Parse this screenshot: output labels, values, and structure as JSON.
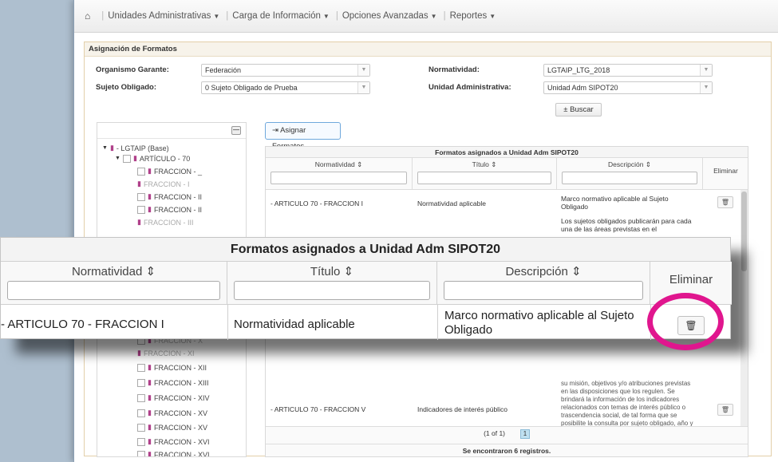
{
  "nav": {
    "items": [
      {
        "label": "Unidades Administrativas"
      },
      {
        "label": "Carga de Información"
      },
      {
        "label": "Opciones Avanzadas"
      },
      {
        "label": "Reportes"
      }
    ]
  },
  "panel": {
    "title": "Asignación de Formatos"
  },
  "form": {
    "organismo_label": "Organismo Garante:",
    "organismo_value": "Federación",
    "sujeto_label": "Sujeto Obligado:",
    "sujeto_value": "0 Sujeto Obligado de Prueba",
    "normatividad_label": "Normatividad:",
    "normatividad_value": "LGTAIP_LTG_2018",
    "unidad_label": "Unidad Administrativa:",
    "unidad_value": "Unidad Adm SIPOT20",
    "buscar_label": "Buscar"
  },
  "tree": {
    "root": "- LGTAIP (Base)",
    "articulo": "ARTÍCULO - 70",
    "items_top": [
      "FRACCION - _",
      "FRACCION - I",
      "FRACCION - II",
      "FRACCION - II",
      "FRACCION - III"
    ],
    "items_bottom": [
      "FRACCION - X",
      "FRACCION - XI",
      "FRACCION - XII",
      "FRACCION - XIII",
      "FRACCION - XIV",
      "FRACCION - XV",
      "FRACCION - XV",
      "FRACCION - XVI",
      "FRACCION - XVI"
    ]
  },
  "assign_button": "Asignar Formatos",
  "grid": {
    "caption": "Formatos asignados a Unidad Adm SIPOT20",
    "col_normatividad": "Normatividad",
    "col_titulo": "Título",
    "col_descripcion": "Descripción",
    "col_eliminar": "Eliminar",
    "row1": {
      "normatividad": "- ARTICULO 70 - FRACCION I",
      "titulo": "Normatividad aplicable",
      "descripcion": "Marco normativo aplicable al Sujeto Obligado"
    },
    "row2_desc": "Los sujetos obligados publicarán para cada una de las áreas previstas en el",
    "row_partial_desc": "su misión, objetivos y/o atribuciones previstas en las disposiciones que los regulen. Se brindará la información de los indicadores relacionados con temas de interés público o trascendencia social, de tal forma que se posibilite la consulta por sujeto obligado, año y objetivos, en relación con los planes de desarrollo nacional, estatal o municipal o programas que se deriven.",
    "row3": {
      "normatividad": "- ARTICULO 70 - FRACCION V",
      "titulo": "Indicadores de interés público"
    },
    "pager_text": "(1 of 1)",
    "page": "1",
    "records": "Se encontraron 6 registros."
  },
  "accent_colors": {
    "highlight_ring": "#e0168e",
    "folder_icon": "#b0408a",
    "assign_border": "#6fa8dc"
  }
}
